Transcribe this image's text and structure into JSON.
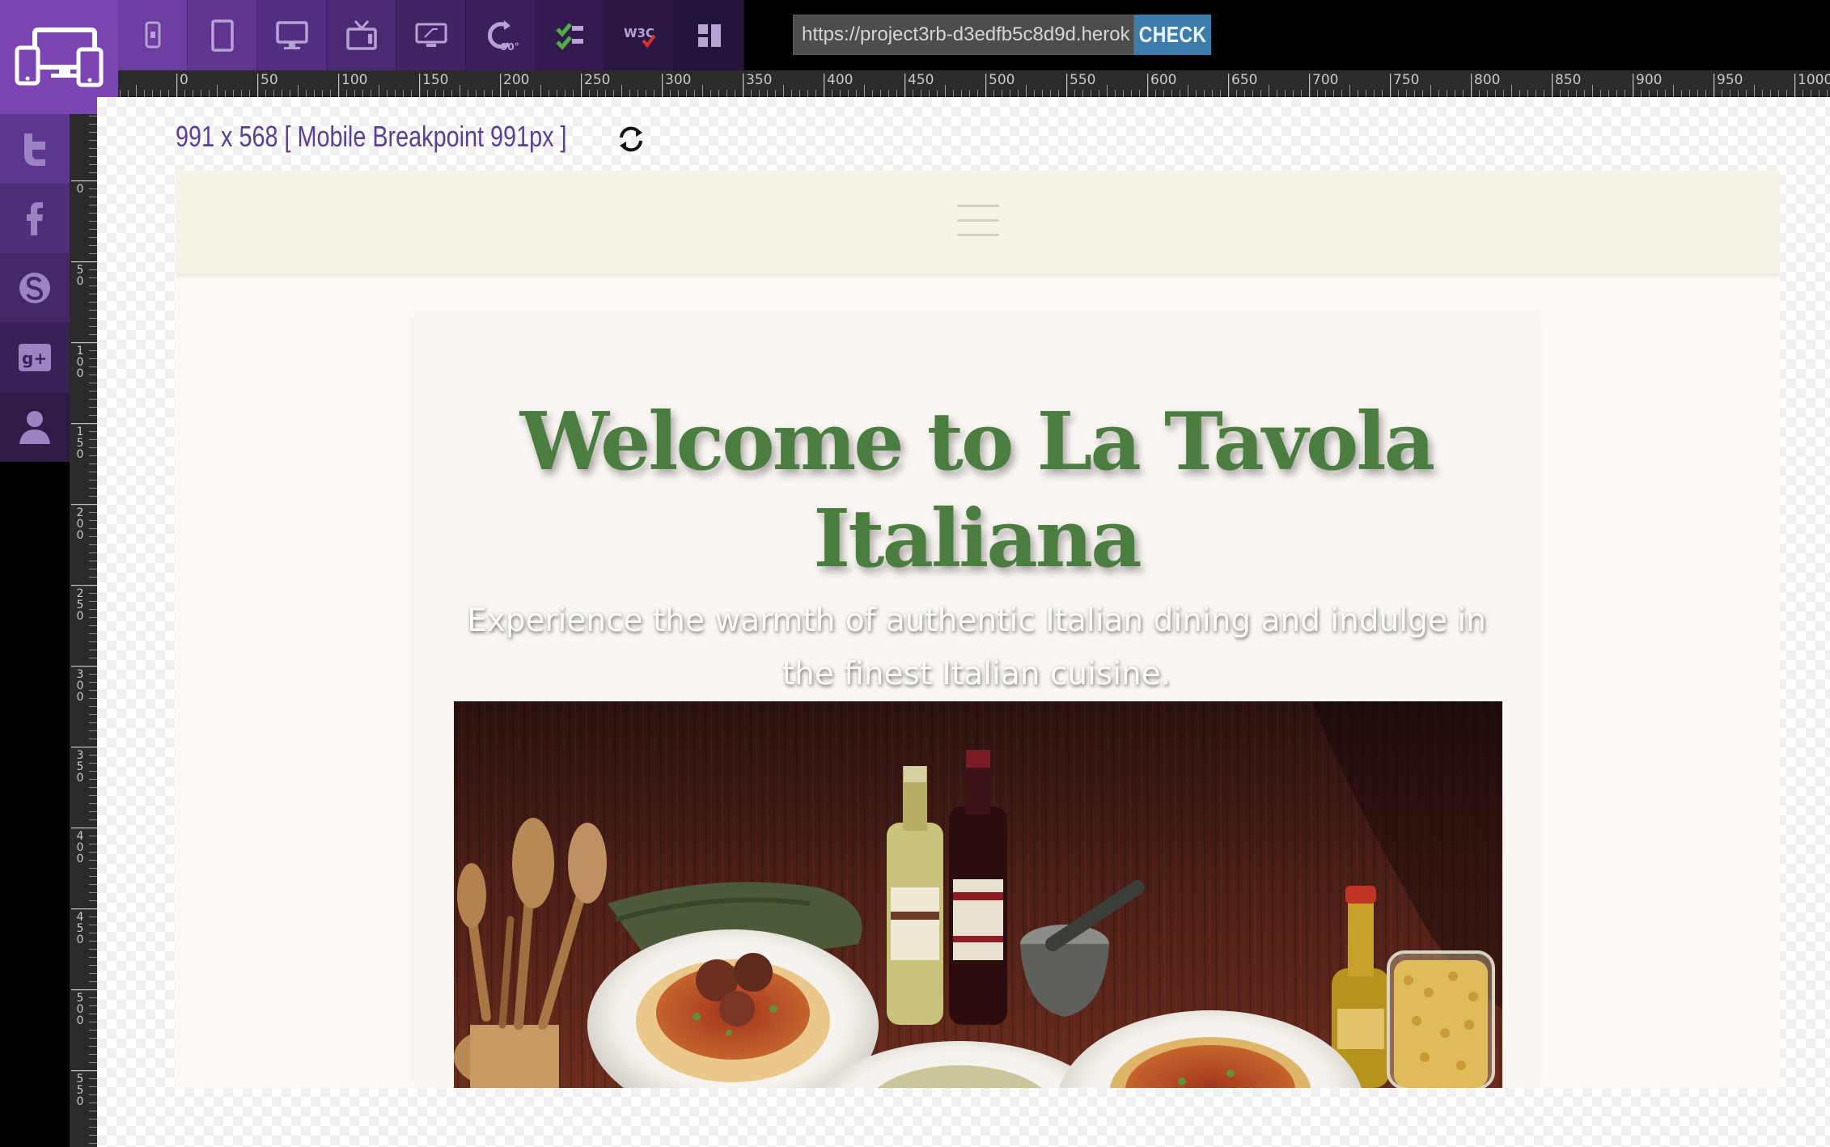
{
  "toolbar": {
    "buttons": [
      {
        "name": "phone",
        "icon": "smartphone-icon"
      },
      {
        "name": "tablet",
        "icon": "tablet-icon"
      },
      {
        "name": "desktop",
        "icon": "desktop-icon"
      },
      {
        "name": "tv",
        "icon": "tv-icon"
      },
      {
        "name": "widescreen",
        "icon": "widescreen-icon"
      },
      {
        "name": "rotate",
        "icon": "rotate-90-icon",
        "label": "90°"
      },
      {
        "name": "checklist",
        "icon": "checklist-icon"
      },
      {
        "name": "w3c-validator",
        "icon": "w3c-icon",
        "label": "W3C"
      },
      {
        "name": "book",
        "icon": "book-icon"
      }
    ],
    "url": "https://project3rb-d3edfb5c8d9d.herok",
    "check_label": "CHECK"
  },
  "ruler": {
    "horizontal_ticks": [
      "0",
      "50",
      "100",
      "150",
      "200",
      "250",
      "300",
      "350",
      "400",
      "450",
      "500",
      "550",
      "600",
      "650",
      "700",
      "750",
      "800",
      "850",
      "900",
      "950",
      "1000"
    ],
    "vertical_ticks": [
      "0",
      "50",
      "100",
      "150",
      "200",
      "250",
      "300",
      "350",
      "400",
      "450",
      "500",
      "550"
    ]
  },
  "sidebar": {
    "items": [
      {
        "name": "twitter",
        "icon": "twitter-icon"
      },
      {
        "name": "facebook",
        "icon": "facebook-icon"
      },
      {
        "name": "skype",
        "icon": "skype-icon"
      },
      {
        "name": "google-plus",
        "icon": "google-plus-icon"
      },
      {
        "name": "user",
        "icon": "user-icon"
      }
    ]
  },
  "viewport": {
    "label": "991 x 568 [ Mobile Breakpoint 991px ]"
  },
  "site": {
    "hero_title": "Welcome to La Tavola Italiana",
    "hero_subtitle": "Experience the warmth of authentic Italian dining and indulge in the finest Italian cuisine."
  },
  "colors": {
    "brand_purple": "#7b45b3",
    "check_blue": "#3d7bab",
    "title_green": "#4a7d3f",
    "nav_bg": "#f6f4e8"
  }
}
